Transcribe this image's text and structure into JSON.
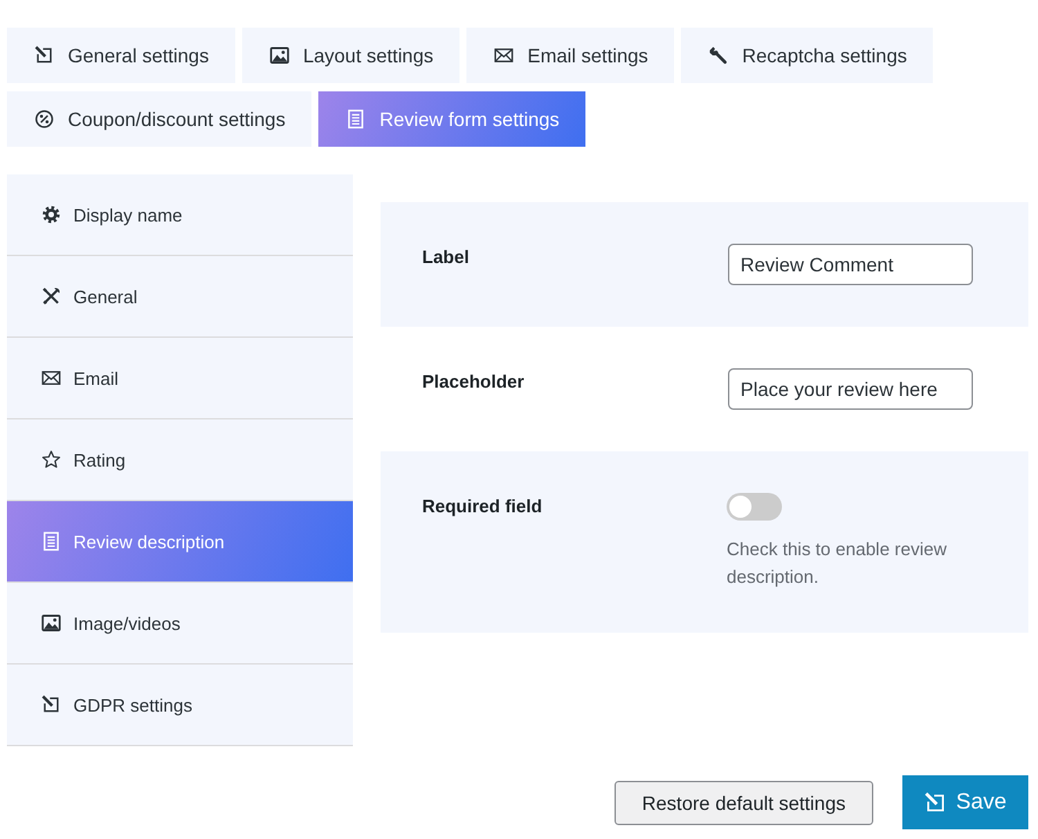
{
  "tabs": [
    {
      "label": "General settings",
      "selected": false
    },
    {
      "label": "Layout settings",
      "selected": false
    },
    {
      "label": "Email settings",
      "selected": false
    },
    {
      "label": "Recaptcha settings",
      "selected": false
    },
    {
      "label": "Coupon/discount settings",
      "selected": false
    },
    {
      "label": "Review form settings",
      "selected": true
    }
  ],
  "sidebar": {
    "items": [
      {
        "label": "Display name",
        "selected": false
      },
      {
        "label": "General",
        "selected": false
      },
      {
        "label": "Email",
        "selected": false
      },
      {
        "label": "Rating",
        "selected": false
      },
      {
        "label": "Review description",
        "selected": true
      },
      {
        "label": "Image/videos",
        "selected": false
      },
      {
        "label": "GDPR settings",
        "selected": false
      }
    ]
  },
  "form": {
    "fields": [
      {
        "kind": "text",
        "label": "Label",
        "value": "Review Comment"
      },
      {
        "kind": "text",
        "label": "Placeholder",
        "value": "Place your review here"
      },
      {
        "kind": "toggle",
        "label": "Required field",
        "on": false,
        "hint": "Check this to enable review description."
      }
    ]
  },
  "buttons": [
    {
      "kind": "secondary",
      "label": "Restore default settings"
    },
    {
      "kind": "primary",
      "label": "Save"
    }
  ]
}
